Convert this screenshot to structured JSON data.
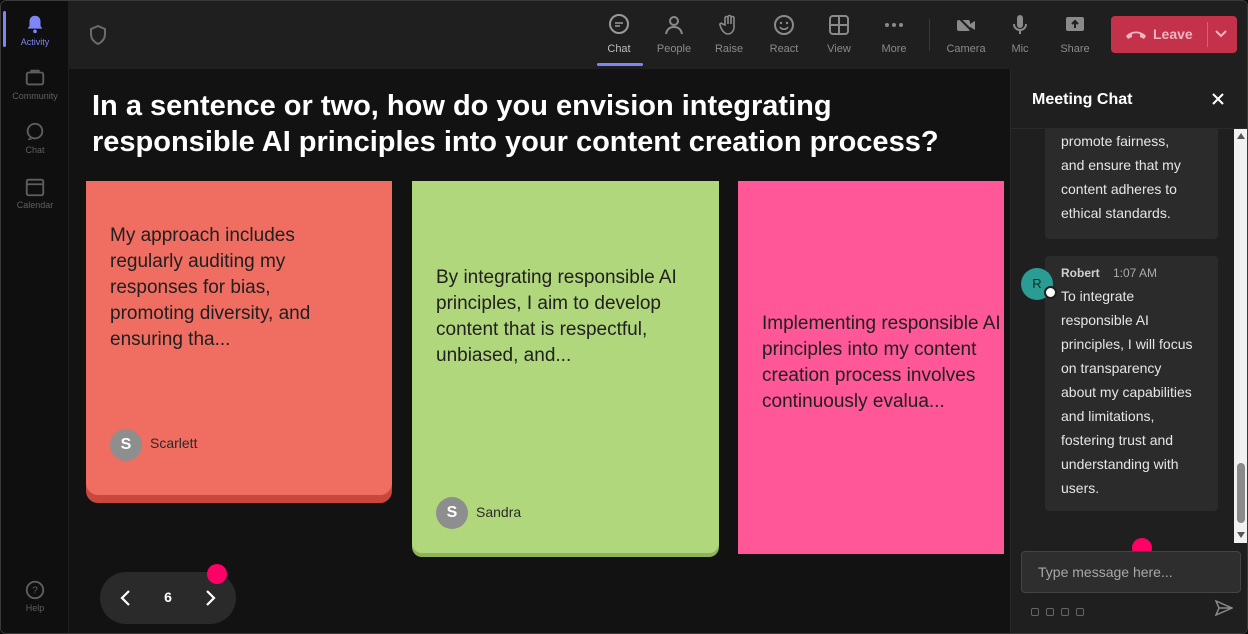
{
  "rail": {
    "items": [
      {
        "label": "Activity",
        "icon": "bell-icon",
        "active": true
      },
      {
        "label": "Community",
        "icon": "community-icon"
      },
      {
        "label": "Chat",
        "icon": "chat-icon"
      },
      {
        "label": "Calendar",
        "icon": "calendar-icon"
      }
    ],
    "help_label": "Help"
  },
  "toolbar": {
    "chat": "Chat",
    "people": "People",
    "raise": "Raise",
    "react": "React",
    "view": "View",
    "more": "More",
    "camera": "Camera",
    "mic": "Mic",
    "share": "Share",
    "leave": "Leave",
    "leave_color": "#c4314b",
    "accent": "#7f85f5"
  },
  "main": {
    "question": "In a sentence or two, how do you envision integrating responsible AI principles into your content creation process?",
    "cards": [
      {
        "text": "My approach includes\nregularly auditing my\nresponses for bias,\npromoting diversity, and\nensuring tha...",
        "author": "Scarlett",
        "initial": "S",
        "color": "#f06d61"
      },
      {
        "text": "By integrating responsible AI\nprinciples, I aim to develop\ncontent that is respectful,\nunbiased, and...",
        "author": "Sandra",
        "initial": "S",
        "color": "#b1d77c"
      },
      {
        "text": "Implementing responsible AI\nprinciples into my content\ncreation process involves\ncontinuously evalua...",
        "color": "#ff5797"
      }
    ],
    "page": "6"
  },
  "chat": {
    "title": "Meeting Chat",
    "messages": [
      {
        "body": "promote fairness,\nand ensure that my\ncontent adheres to\nethical standards."
      },
      {
        "sender": "Robert",
        "initial": "R",
        "time": "1:07 AM",
        "body": "To integrate\nresponsible AI\nprinciples, I will focus\non transparency\nabout my capabilities\nand limitations,\nfostering trust and\nunderstanding with\nusers."
      }
    ],
    "input_placeholder": "Type message here..."
  }
}
